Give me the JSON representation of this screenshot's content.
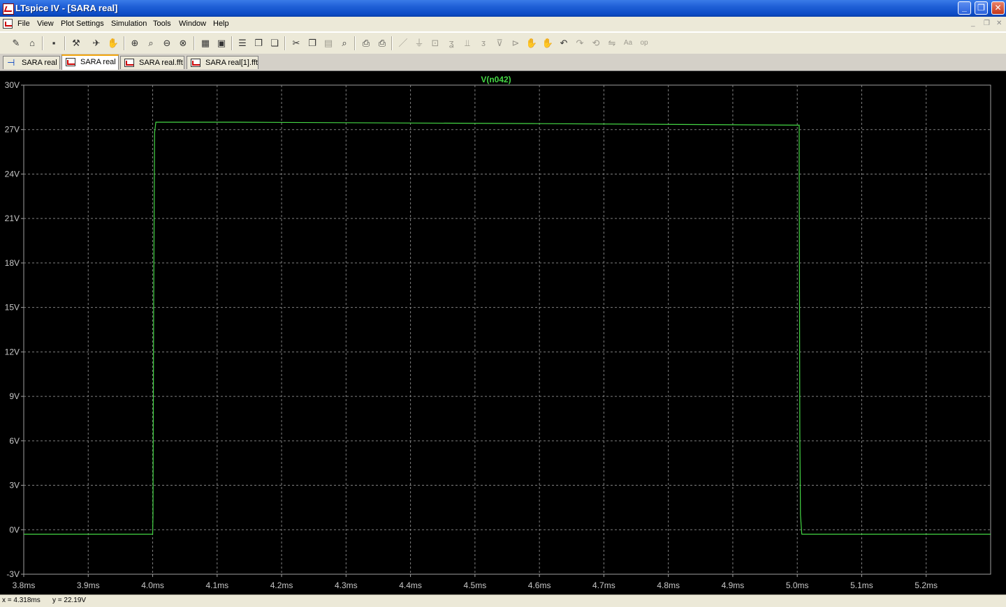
{
  "window": {
    "title": "LTspice IV - [SARA real]"
  },
  "menu": {
    "items": [
      "File",
      "View",
      "Plot Settings",
      "Simulation",
      "Tools",
      "Window",
      "Help"
    ]
  },
  "toolbar": {
    "buttons": [
      {
        "name": "new-schematic-icon",
        "glyph": "✎",
        "dim": false
      },
      {
        "name": "open-icon",
        "glyph": "⌂",
        "dim": false
      },
      {
        "name": "save-icon",
        "glyph": "▪",
        "dim": false
      },
      {
        "name": "control-panel-icon",
        "glyph": "⚒",
        "dim": false
      },
      {
        "name": "run-icon",
        "glyph": "✈",
        "dim": false
      },
      {
        "name": "halt-icon",
        "glyph": "✋",
        "dim": true
      },
      {
        "name": "zoom-in-icon",
        "glyph": "⊕",
        "dim": false
      },
      {
        "name": "zoom-area-icon",
        "glyph": "⌕",
        "dim": false
      },
      {
        "name": "zoom-out-icon",
        "glyph": "⊖",
        "dim": false
      },
      {
        "name": "zoom-cancel-icon",
        "glyph": "⊗",
        "dim": false
      },
      {
        "name": "autorange-icon",
        "glyph": "▦",
        "dim": false
      },
      {
        "name": "fit-icon",
        "glyph": "▣",
        "dim": false
      },
      {
        "name": "tile-horizontal-icon",
        "glyph": "☰",
        "dim": false
      },
      {
        "name": "cascade-icon",
        "glyph": "❐",
        "dim": false
      },
      {
        "name": "tile-vertical-icon",
        "glyph": "❏",
        "dim": false
      },
      {
        "name": "cut-icon",
        "glyph": "✂",
        "dim": false
      },
      {
        "name": "copy-icon",
        "glyph": "❐",
        "dim": false
      },
      {
        "name": "paste-icon",
        "glyph": "▤",
        "dim": true
      },
      {
        "name": "find-icon",
        "glyph": "⌕",
        "dim": false
      },
      {
        "name": "print-setup-icon",
        "glyph": "⎙",
        "dim": false
      },
      {
        "name": "print-icon",
        "glyph": "⎙",
        "dim": false
      },
      {
        "name": "wire-icon",
        "glyph": "／",
        "dim": true
      },
      {
        "name": "ground-icon",
        "glyph": "⏚",
        "dim": true
      },
      {
        "name": "label-net-icon",
        "glyph": "⊡",
        "dim": true
      },
      {
        "name": "resistor-icon",
        "glyph": "ʓ",
        "dim": true
      },
      {
        "name": "capacitor-icon",
        "glyph": "⫫",
        "dim": true
      },
      {
        "name": "inductor-icon",
        "glyph": "ᴣ",
        "dim": true
      },
      {
        "name": "diode-icon",
        "glyph": "⊽",
        "dim": true
      },
      {
        "name": "component-icon",
        "glyph": "⊳",
        "dim": true
      },
      {
        "name": "move-icon",
        "glyph": "✋",
        "dim": true
      },
      {
        "name": "drag-icon",
        "glyph": "✋",
        "dim": true
      },
      {
        "name": "undo-icon",
        "glyph": "↶",
        "dim": false
      },
      {
        "name": "redo-icon",
        "glyph": "↷",
        "dim": true
      },
      {
        "name": "rotate-icon",
        "glyph": "⟲",
        "dim": true
      },
      {
        "name": "mirror-icon",
        "glyph": "⇋",
        "dim": true
      },
      {
        "name": "text-icon",
        "glyph": "Aa",
        "dim": true
      },
      {
        "name": "spice-directive-icon",
        "glyph": "op",
        "dim": true
      }
    ]
  },
  "tabs": [
    {
      "label": "SARA real",
      "kind": "schematic",
      "active": false
    },
    {
      "label": "SARA real",
      "kind": "plot",
      "active": true
    },
    {
      "label": "SARA real.fft",
      "kind": "plot",
      "active": false
    },
    {
      "label": "SARA real[1].fft",
      "kind": "plot",
      "active": false
    }
  ],
  "chart_data": {
    "type": "line",
    "title": "V(n042)",
    "xlabel": "",
    "ylabel": "",
    "xlim": [
      3.8,
      5.3
    ],
    "ylim": [
      -3,
      30
    ],
    "x_ticks": [
      "3.8ms",
      "3.9ms",
      "4.0ms",
      "4.1ms",
      "4.2ms",
      "4.3ms",
      "4.4ms",
      "4.5ms",
      "4.6ms",
      "4.7ms",
      "4.8ms",
      "4.9ms",
      "5.0ms",
      "5.1ms",
      "5.2ms"
    ],
    "y_ticks": [
      "30V",
      "27V",
      "24V",
      "21V",
      "18V",
      "15V",
      "12V",
      "9V",
      "6V",
      "3V",
      "0V",
      "-3V"
    ],
    "grid": true,
    "background": "#000000",
    "grid_color": "#808080",
    "series": [
      {
        "name": "V(n042)",
        "color": "#44d644",
        "x": [
          3.8,
          4.0,
          4.0005,
          4.0015,
          4.003,
          4.005,
          4.13,
          4.6,
          5.003,
          5.003,
          5.004,
          5.005,
          5.007,
          5.3
        ],
        "y": [
          -0.3,
          -0.3,
          1.0,
          14.5,
          26.8,
          27.5,
          27.5,
          27.4,
          27.3,
          24.5,
          6.5,
          1.0,
          -0.3,
          -0.3
        ]
      }
    ]
  },
  "status": {
    "x": "x = 4.318ms",
    "y": "y = 22.19V"
  }
}
